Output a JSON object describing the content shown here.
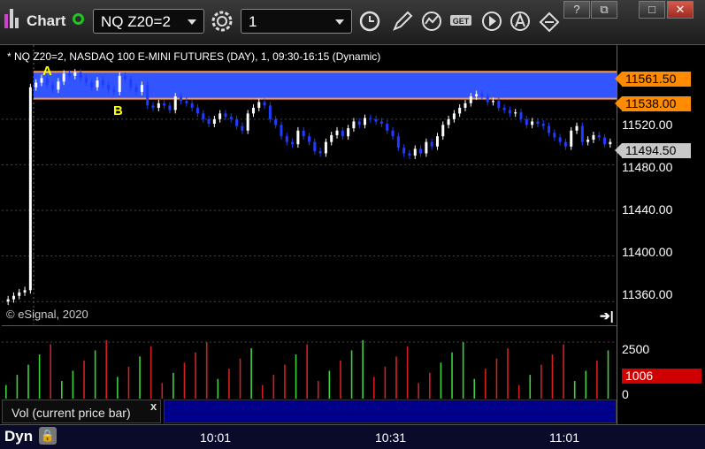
{
  "toolbar": {
    "title": "Chart",
    "symbol": "NQ Z20=2",
    "interval": "1",
    "icons": [
      "chart-logo-icon",
      "link-icon",
      "settings-gear-icon",
      "clock-icon",
      "pencil-draw-icon",
      "indicator-icon",
      "get-icon",
      "play-icon",
      "alert-icon",
      "cursor-icon"
    ],
    "window_buttons": [
      "?",
      "⧉",
      "□",
      "✕"
    ]
  },
  "colors": {
    "background": "#000000",
    "up_candle": "#ffffff",
    "down_candle": "#1f3cff",
    "highlight_band": "#3355ff",
    "band_line": "#ff9933",
    "tag_orange": "#ff8c00",
    "tag_gray": "#c8c8c8",
    "vol_up": "#3cd23c",
    "vol_down": "#d22020",
    "vol_tag": "#d10000",
    "study_bar": "#00008b",
    "label_yellow": "#ffff00"
  },
  "chart": {
    "info_line": "* NQ Z20=2, NASDAQ 100 E-MINI FUTURES (DAY), 1, 09:30-16:15 (Dynamic)",
    "copyright": "© eSignal, 2020",
    "label_a": "A",
    "label_b": "B",
    "price_axis_ticks": [
      "11520.00",
      "11480.00",
      "11440.00",
      "11400.00",
      "11360.00"
    ],
    "price_tags": {
      "upper": "11561.50",
      "lower": "11538.00",
      "last": "11494.50"
    },
    "volume_axis_ticks": [
      "2500",
      "0"
    ],
    "volume_tag": "1006",
    "study_label": "Vol (current price bar)",
    "study_close": "x",
    "dyn_label": "Dyn",
    "time_labels": [
      "10:01",
      "10:31",
      "11:01"
    ]
  },
  "chart_data": {
    "type": "candlestick",
    "title": "NQ Z20=2, NASDAQ 100 E-MINI FUTURES (DAY), 1, 09:30-16:15 (Dynamic)",
    "y_range": [
      11340,
      11585
    ],
    "y_ticks": [
      11360,
      11400,
      11440,
      11480,
      11520
    ],
    "x_labels": [
      "10:01",
      "10:31",
      "11:01"
    ],
    "horizontal_levels": [
      11561.5,
      11538.0
    ],
    "last_price": 11494.5,
    "close_series": [
      11362,
      11365,
      11368,
      11370,
      11548,
      11552,
      11556,
      11550,
      11546,
      11553,
      11560,
      11558,
      11561,
      11556,
      11552,
      11548,
      11554,
      11550,
      11546,
      11544,
      11558,
      11555,
      11548,
      11544,
      11550,
      11532,
      11530,
      11534,
      11532,
      11528,
      11540,
      11536,
      11534,
      11530,
      11525,
      11520,
      11516,
      11520,
      11525,
      11522,
      11520,
      11514,
      11510,
      11525,
      11530,
      11535,
      11532,
      11520,
      11515,
      11505,
      11500,
      11498,
      11510,
      11505,
      11500,
      11492,
      11490,
      11500,
      11506,
      11510,
      11505,
      11512,
      11518,
      11515,
      11521,
      11520,
      11518,
      11516,
      11510,
      11505,
      11495,
      11490,
      11488,
      11494,
      11490,
      11500,
      11496,
      11505,
      11515,
      11520,
      11525,
      11530,
      11534,
      11540,
      11542,
      11540,
      11535,
      11536,
      11530,
      11528,
      11525,
      11526,
      11520,
      11515,
      11518,
      11516,
      11514,
      11508,
      11504,
      11500,
      11496,
      11510,
      11514,
      11500,
      11502,
      11506,
      11504,
      11498,
      11500
    ],
    "volume_axis_max": 2500,
    "last_volume": 1006
  }
}
